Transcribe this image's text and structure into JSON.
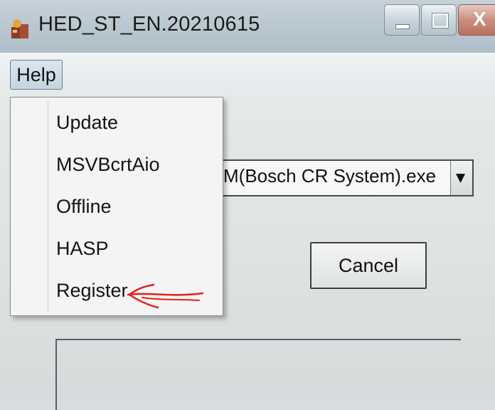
{
  "window": {
    "title": "HED_ST_EN.20210615",
    "minimize_icon": "minimize-icon",
    "maximize_icon": "maximize-icon",
    "close_icon": "close-icon",
    "close_label": "X"
  },
  "menubar": {
    "help_label": "Help"
  },
  "help_menu": {
    "items": [
      {
        "label": "Update"
      },
      {
        "label": "MSVBcrtAio"
      },
      {
        "label": "Offline"
      },
      {
        "label": "HASP"
      },
      {
        "label": "Register"
      }
    ]
  },
  "main": {
    "combo_value": "M(Bosch CR System).exe",
    "combo_arrow": "▼",
    "cancel_label": "Cancel"
  },
  "annotation": {
    "type": "red-hand-drawn-arrow",
    "color": "#e0221c",
    "points_to": "Register"
  },
  "colors": {
    "titlebar": "#b8c6cf",
    "menu_highlight": "#c3d5e1",
    "close_button": "#c98e80"
  }
}
